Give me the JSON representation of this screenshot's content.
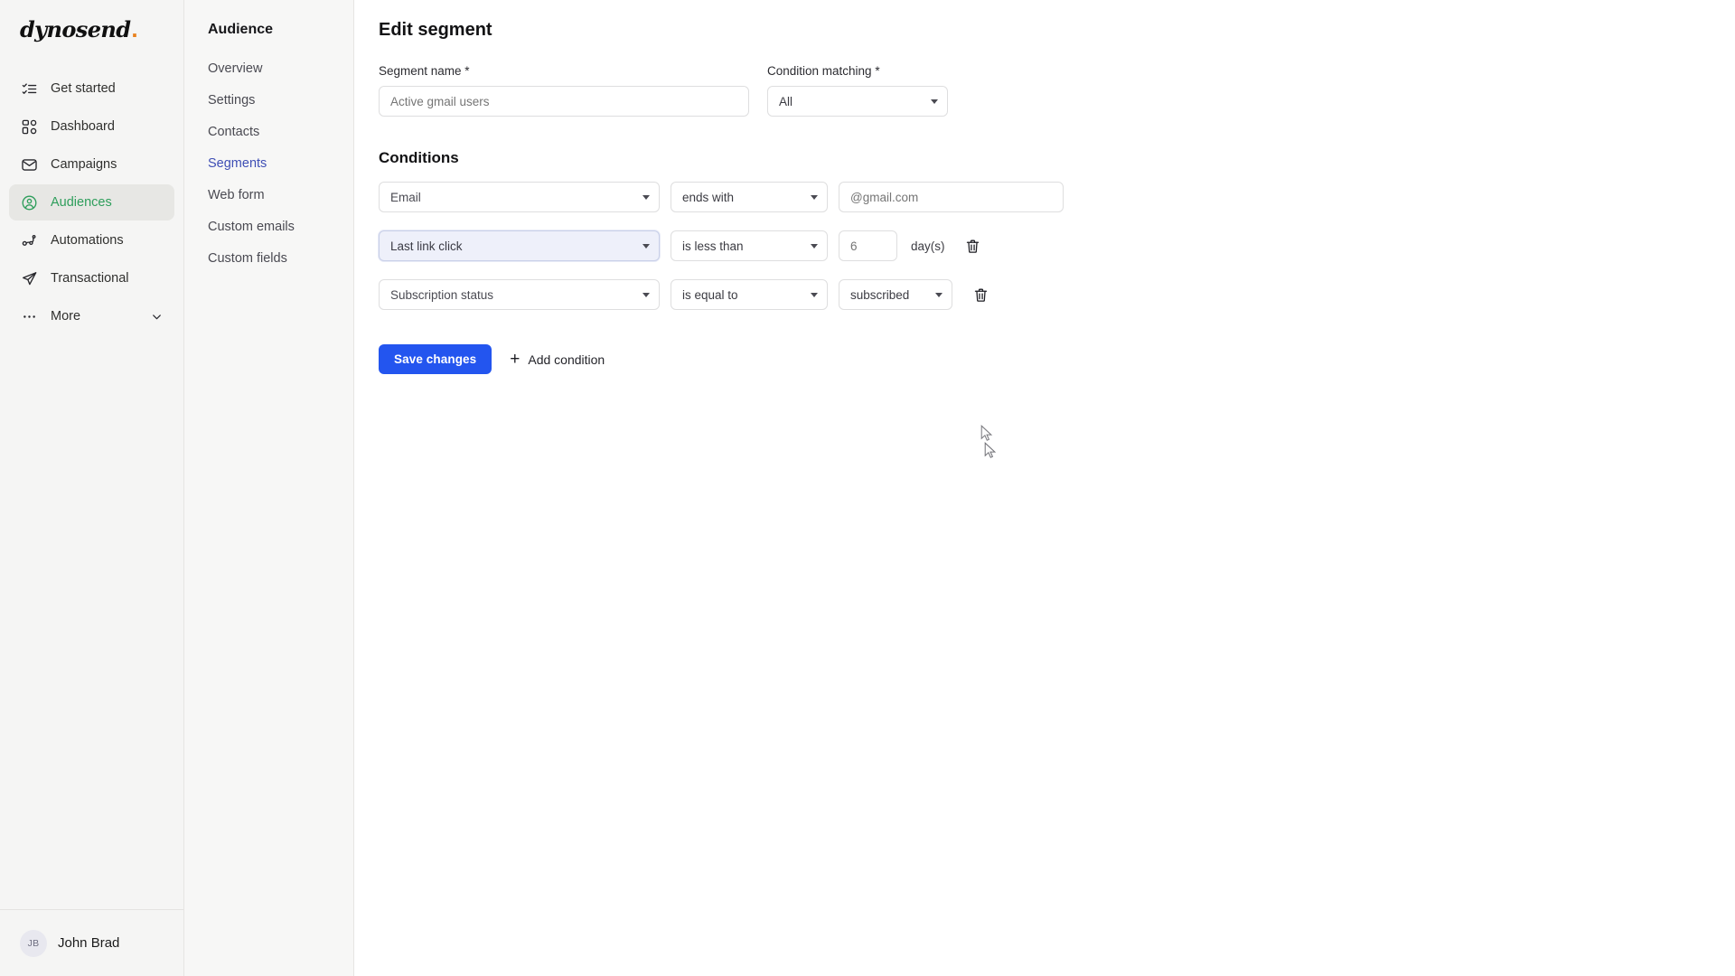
{
  "brand": {
    "name": "dynosend",
    "dot": "."
  },
  "rail": {
    "items": [
      {
        "label": "Get started",
        "icon": "checklist-icon",
        "active": false,
        "chevron": false
      },
      {
        "label": "Dashboard",
        "icon": "dashboard-icon",
        "active": false,
        "chevron": false
      },
      {
        "label": "Campaigns",
        "icon": "envelope-icon",
        "active": false,
        "chevron": false
      },
      {
        "label": "Audiences",
        "icon": "user-circle-icon",
        "active": true,
        "chevron": false
      },
      {
        "label": "Automations",
        "icon": "automation-icon",
        "active": false,
        "chevron": false
      },
      {
        "label": "Transactional",
        "icon": "paper-plane-icon",
        "active": false,
        "chevron": false
      },
      {
        "label": "More",
        "icon": "ellipsis-icon",
        "active": false,
        "chevron": true
      }
    ],
    "user": {
      "initials": "JB",
      "name": "John Brad"
    }
  },
  "subnav": {
    "title": "Audience",
    "items": [
      {
        "label": "Overview",
        "current": false
      },
      {
        "label": "Settings",
        "current": false
      },
      {
        "label": "Contacts",
        "current": false
      },
      {
        "label": "Segments",
        "current": true
      },
      {
        "label": "Web form",
        "current": false
      },
      {
        "label": "Custom emails",
        "current": false
      },
      {
        "label": "Custom fields",
        "current": false
      }
    ]
  },
  "main": {
    "page_title": "Edit segment",
    "segment_name": {
      "label": "Segment name *",
      "placeholder": "Active gmail users",
      "value": ""
    },
    "condition_matching": {
      "label": "Condition matching *",
      "selected": "All"
    },
    "conditions_heading": "Conditions",
    "conditions": [
      {
        "attribute": "Email",
        "attribute_focused": false,
        "operator": "ends with",
        "value_type": "text",
        "value": "@gmail.com",
        "units": "",
        "deletable": false
      },
      {
        "attribute": "Last link click",
        "attribute_focused": true,
        "operator": "is less than",
        "value_type": "number",
        "value": "6",
        "units": "day(s)",
        "deletable": true
      },
      {
        "attribute": "Subscription status",
        "attribute_focused": false,
        "operator": "is equal to",
        "value_type": "select",
        "value": "subscribed",
        "units": "",
        "deletable": true
      }
    ],
    "save_label": "Save changes",
    "add_condition_label": "Add condition"
  },
  "colors": {
    "accent_green": "#2e9e5b",
    "accent_blue": "#2355ef",
    "link_indigo": "#3f4fb5",
    "brand_dot": "#e8821e",
    "focus_bg": "#eef0fa",
    "rail_bg": "#f5f5f4",
    "subnav_bg": "#f7f7f6"
  }
}
